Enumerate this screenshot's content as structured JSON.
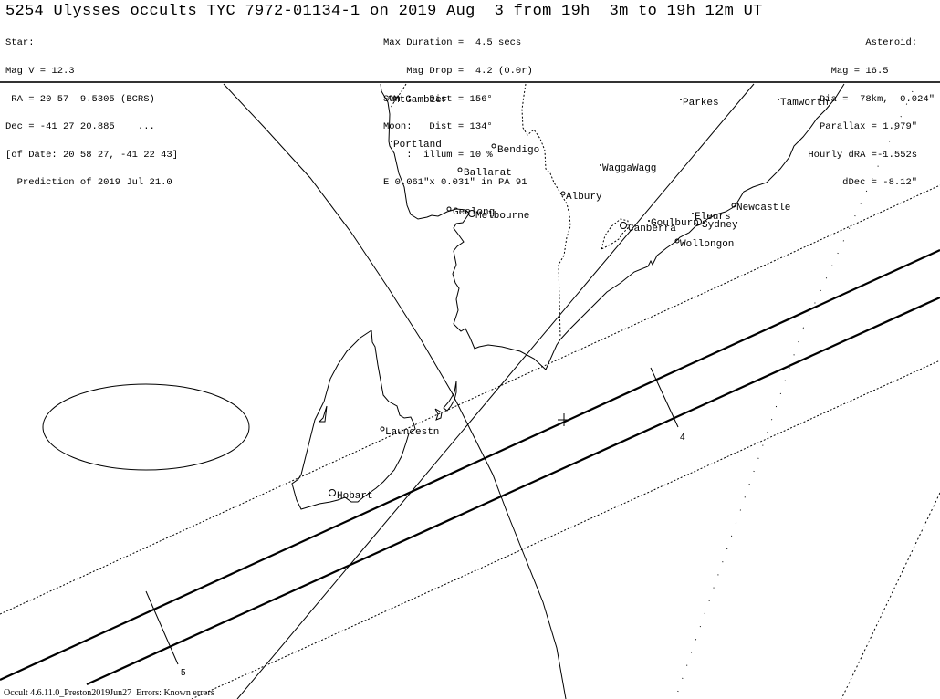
{
  "title": "5254 Ulysses occults TYC 7972-01134-1 on 2019 Aug  3 from 19h  3m to 19h 12m UT",
  "star": {
    "lines": [
      "Star:",
      "Mag V = 12.3",
      " RA = 20 57  9.5305 (BCRS)",
      "Dec = -41 27 20.885    ...",
      "[of Date: 20 58 27, -41 22 43]",
      "  Prediction of 2019 Jul 21.0"
    ]
  },
  "event": {
    "lines": [
      "Max Duration =  4.5 secs",
      "    Mag Drop =  4.2 (0.0r)",
      "Sun :   Dist = 156°",
      "Moon:   Dist = 134°",
      "    :  illum = 10 %",
      "E 0.061\"x 0.031\" in PA 91"
    ]
  },
  "asteroid": {
    "lines": [
      "Asteroid:   ",
      "Mag = 16.5        ",
      "Dia =  78km,  0.024\"",
      "Parallax = 1.979\"   ",
      "Hourly dRA =-1.552s   ",
      "dDec = -8.12\"   "
    ]
  },
  "map": {
    "cities": [
      {
        "name": "MtGambier",
        "marker": "small-circle"
      },
      {
        "name": "Portland",
        "marker": "dot"
      },
      {
        "name": "Bendigo",
        "marker": "small-circle"
      },
      {
        "name": "Ballarat",
        "marker": "small-circle"
      },
      {
        "name": "Geelong",
        "marker": "small-circle"
      },
      {
        "name": "Melbourne",
        "marker": "large-circle"
      },
      {
        "name": "WaggaWagg",
        "marker": "dot"
      },
      {
        "name": "Albury",
        "marker": "small-circle"
      },
      {
        "name": "Parkes",
        "marker": "dot"
      },
      {
        "name": "Tamworth",
        "marker": "dot"
      },
      {
        "name": "Newcastle",
        "marker": "small-circle"
      },
      {
        "name": "Fleurs",
        "marker": "dot"
      },
      {
        "name": "Goulburn",
        "marker": "dot"
      },
      {
        "name": "Sydney",
        "marker": "large-circle"
      },
      {
        "name": "Canberra",
        "marker": "large-circle"
      },
      {
        "name": "Wollongon",
        "marker": "small-circle"
      },
      {
        "name": "Launcestn",
        "marker": "small-circle"
      },
      {
        "name": "Hobart",
        "marker": "large-circle"
      }
    ],
    "time_ticks": [
      {
        "label": "4"
      },
      {
        "label": "5"
      }
    ],
    "center_marker": "cross"
  },
  "footer": "Occult 4.6.11.0_Preston2019Jun27  Errors: Known errors"
}
